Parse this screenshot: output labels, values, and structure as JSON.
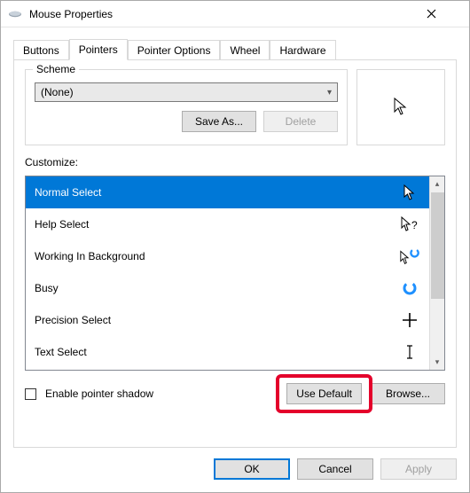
{
  "window": {
    "title": "Mouse Properties"
  },
  "tabs": {
    "items": [
      "Buttons",
      "Pointers",
      "Pointer Options",
      "Wheel",
      "Hardware"
    ],
    "active_index": 1
  },
  "scheme": {
    "legend": "Scheme",
    "selected": "(None)",
    "save_label": "Save As...",
    "delete_label": "Delete"
  },
  "customize": {
    "label": "Customize:",
    "items": [
      {
        "label": "Normal Select",
        "icon": "arrow-white"
      },
      {
        "label": "Help Select",
        "icon": "arrow-help"
      },
      {
        "label": "Working In Background",
        "icon": "arrow-ring"
      },
      {
        "label": "Busy",
        "icon": "ring"
      },
      {
        "label": "Precision Select",
        "icon": "crosshair"
      },
      {
        "label": "Text Select",
        "icon": "ibeam"
      }
    ],
    "selected_index": 0
  },
  "options": {
    "enable_shadow_label": "Enable pointer shadow",
    "use_default_label": "Use Default",
    "browse_label": "Browse..."
  },
  "dialog_buttons": {
    "ok": "OK",
    "cancel": "Cancel",
    "apply": "Apply"
  }
}
